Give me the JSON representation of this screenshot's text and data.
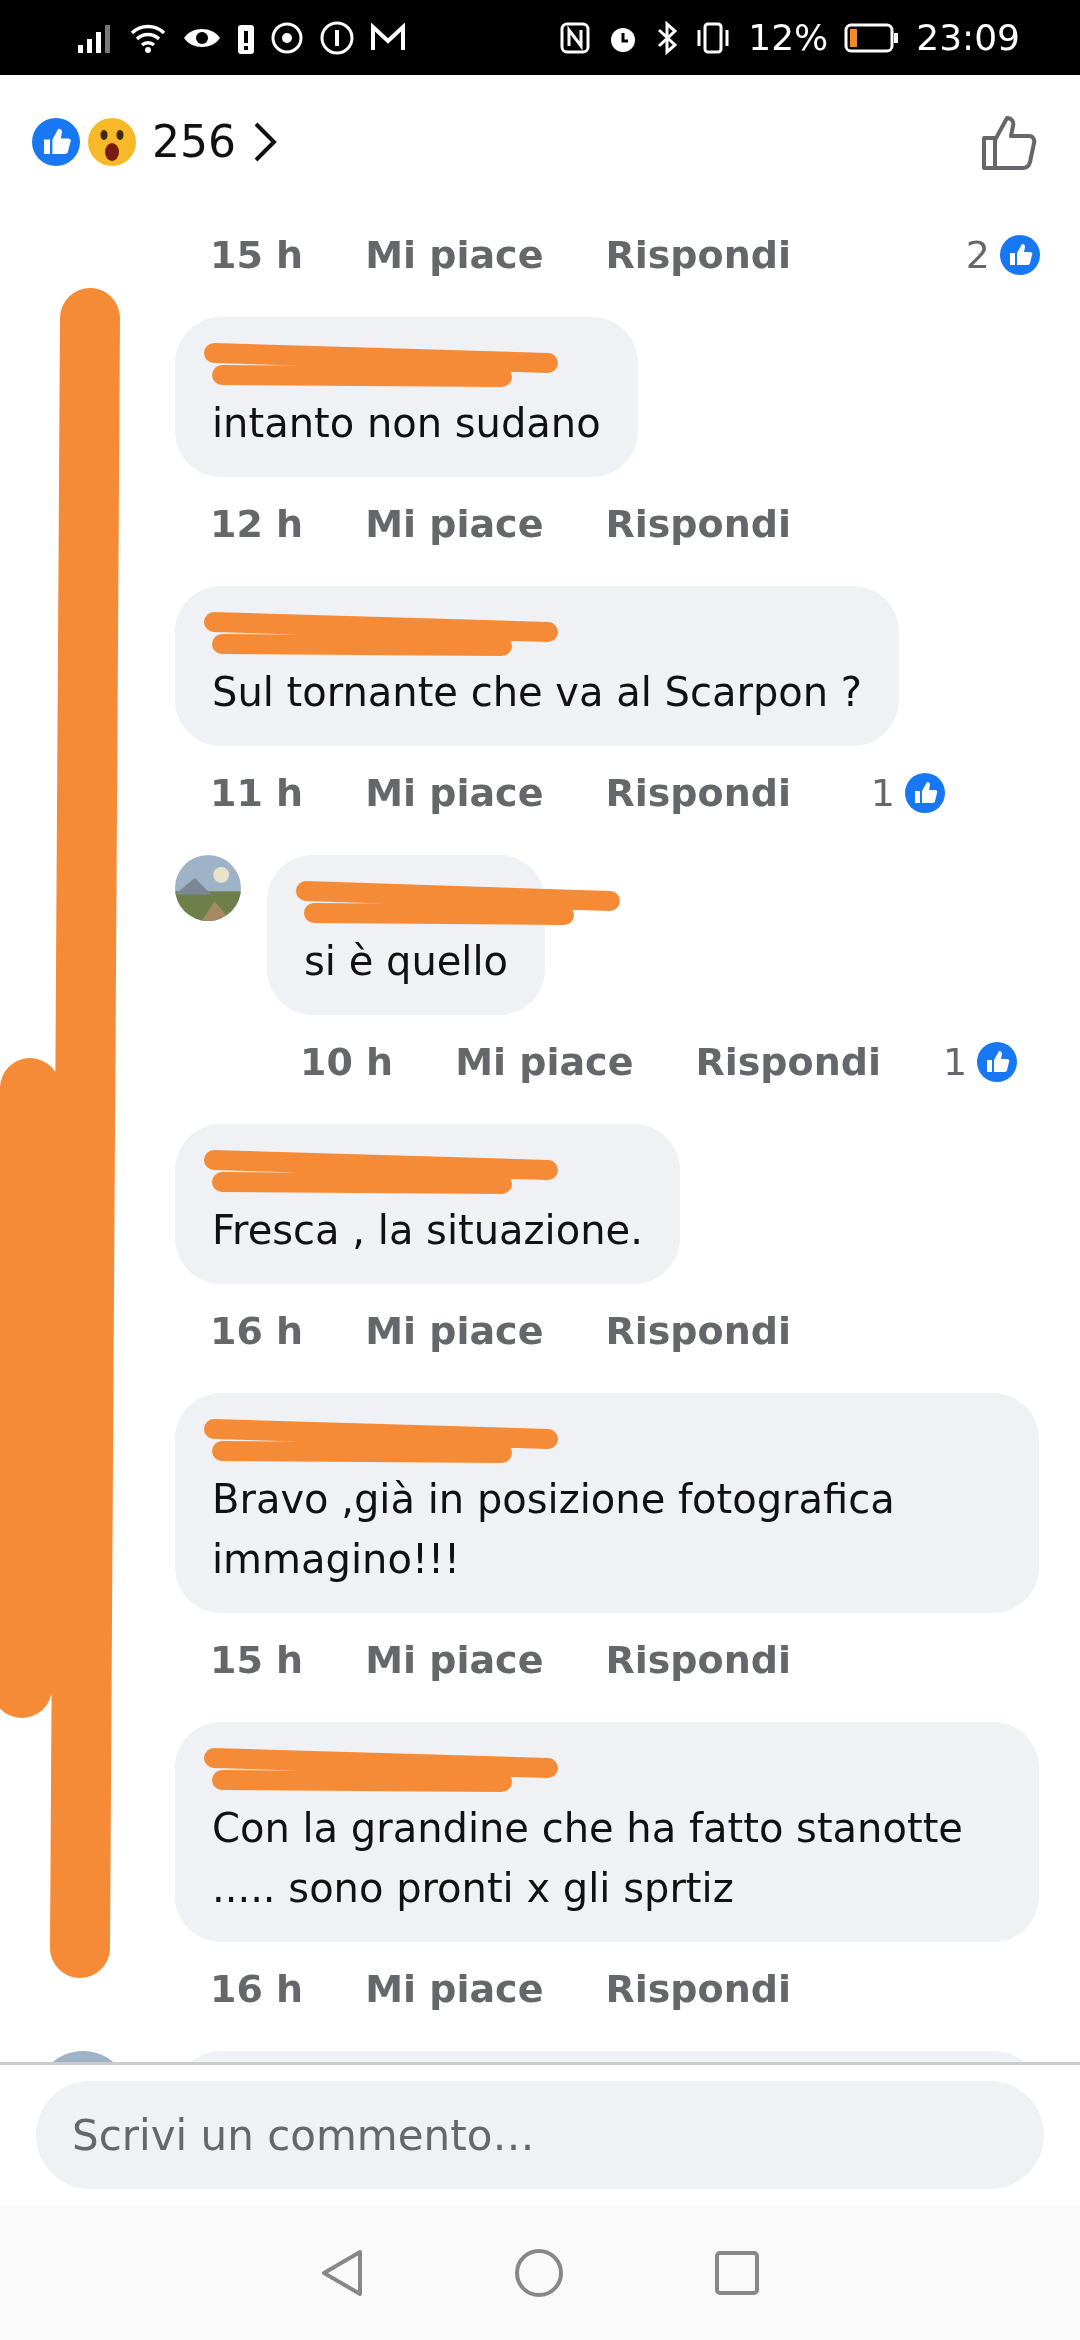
{
  "status_bar": {
    "battery": "12%",
    "time": "23:09"
  },
  "header": {
    "reaction_count": "256"
  },
  "comments": [
    {
      "kind": "meta",
      "time": "15 h",
      "like": "Mi piace",
      "reply": "Rispondi",
      "likes": "2"
    },
    {
      "kind": "comment",
      "text": "intanto non sudano",
      "time": "12 h",
      "like": "Mi piace",
      "reply": "Rispondi"
    },
    {
      "kind": "comment",
      "text": "Sul tornante che va al Scarpon ?",
      "time": "11 h",
      "like": "Mi piace",
      "reply": "Rispondi",
      "likes": "1"
    },
    {
      "kind": "reply",
      "text": "si è quello",
      "time": "10 h",
      "like": "Mi piace",
      "reply": "Rispondi",
      "likes": "1"
    },
    {
      "kind": "comment",
      "text": "Fresca , la situazione.",
      "time": "16 h",
      "like": "Mi piace",
      "reply": "Rispondi"
    },
    {
      "kind": "comment",
      "text": "Bravo ,già in posizione fotografica immagino!!!",
      "time": "15 h",
      "like": "Mi piace",
      "reply": "Rispondi"
    },
    {
      "kind": "comment",
      "text": "Con la grandine che ha fatto stanotte ..... sono pronti x gli sprtiz",
      "time": "16 h",
      "like": "Mi piace",
      "reply": "Rispondi"
    },
    {
      "kind": "partial"
    }
  ],
  "composer": {
    "placeholder": "Scrivi un commento…"
  }
}
